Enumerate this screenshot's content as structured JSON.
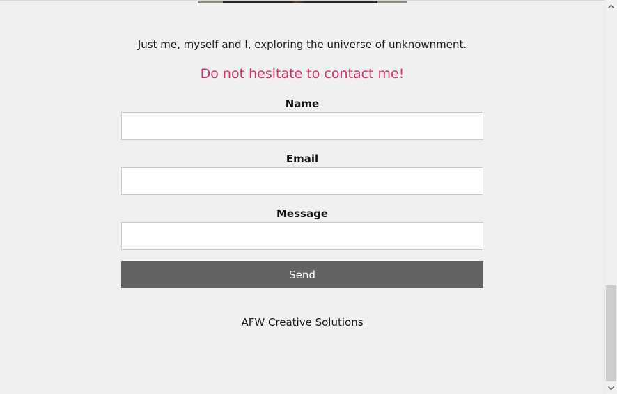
{
  "page": {
    "tagline": "Just me, myself and I, exploring the universe of unknownment.",
    "contact_heading": "Do not hesitate to contact me!",
    "accent_color": "#d6336c"
  },
  "form": {
    "name_label": "Name",
    "name_value": "",
    "email_label": "Email",
    "email_value": "",
    "message_label": "Message",
    "message_value": "",
    "send_label": "Send",
    "button_color": "#636363"
  },
  "footer": {
    "text": "AFW Creative Solutions"
  },
  "scrollbar": {
    "up_icon": "chevron-up-icon",
    "down_icon": "chevron-down-icon"
  }
}
